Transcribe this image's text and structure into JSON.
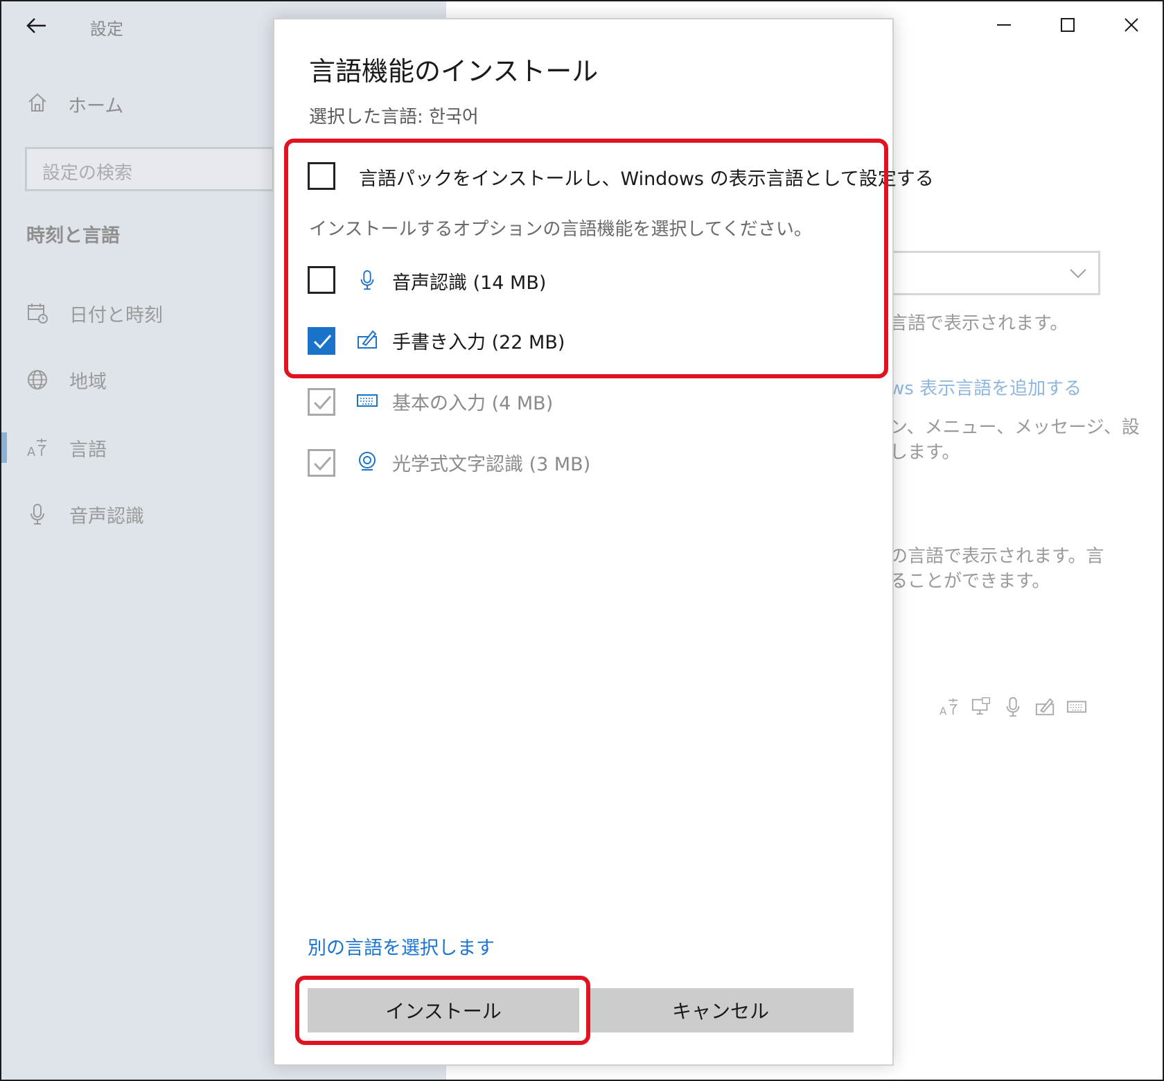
{
  "window": {
    "title": "設定",
    "home_label": "ホーム",
    "search_placeholder": "設定の検索",
    "section_title": "時刻と言語",
    "nav_items": [
      {
        "label": "日付と時刻",
        "icon": "calendar-clock-icon"
      },
      {
        "label": "地域",
        "icon": "globe-icon"
      },
      {
        "label": "言語",
        "icon": "language-icon"
      },
      {
        "label": "音声認識",
        "icon": "microphone-icon"
      }
    ],
    "active_nav_index": 2
  },
  "background_right": {
    "text1": "言語で表示されます。",
    "link": "ws 表示言語を追加する",
    "text2a": "ン、メニュー、メッセージ、設",
    "text2b": "します。",
    "text3a": "の言語で表示されます。言",
    "text3b": "ることができます。"
  },
  "dialog": {
    "title": "言語機能のインストール",
    "selected_language": "選択した言語: 한국어",
    "display_language_option": {
      "label": "言語パックをインストールし、Windows の表示言語として設定する",
      "checked": false
    },
    "optional_help": "インストールするオプションの言語機能を選択してください。",
    "features": [
      {
        "label": "音声認識 (14 MB)",
        "icon": "microphone-icon",
        "checked": false,
        "enabled": true
      },
      {
        "label": "手書き入力 (22 MB)",
        "icon": "pen-icon",
        "checked": true,
        "enabled": true
      },
      {
        "label": "基本の入力 (4 MB)",
        "icon": "keyboard-icon",
        "checked": true,
        "enabled": false
      },
      {
        "label": "光学式文字認識 (3 MB)",
        "icon": "ocr-camera-icon",
        "checked": true,
        "enabled": false
      }
    ],
    "choose_other_link": "別の言語を選択します",
    "install_button": "インストール",
    "cancel_button": "キャンセル"
  },
  "colors": {
    "accent": "#1a73c8",
    "highlight": "#e01421",
    "link": "#1d74d0"
  }
}
